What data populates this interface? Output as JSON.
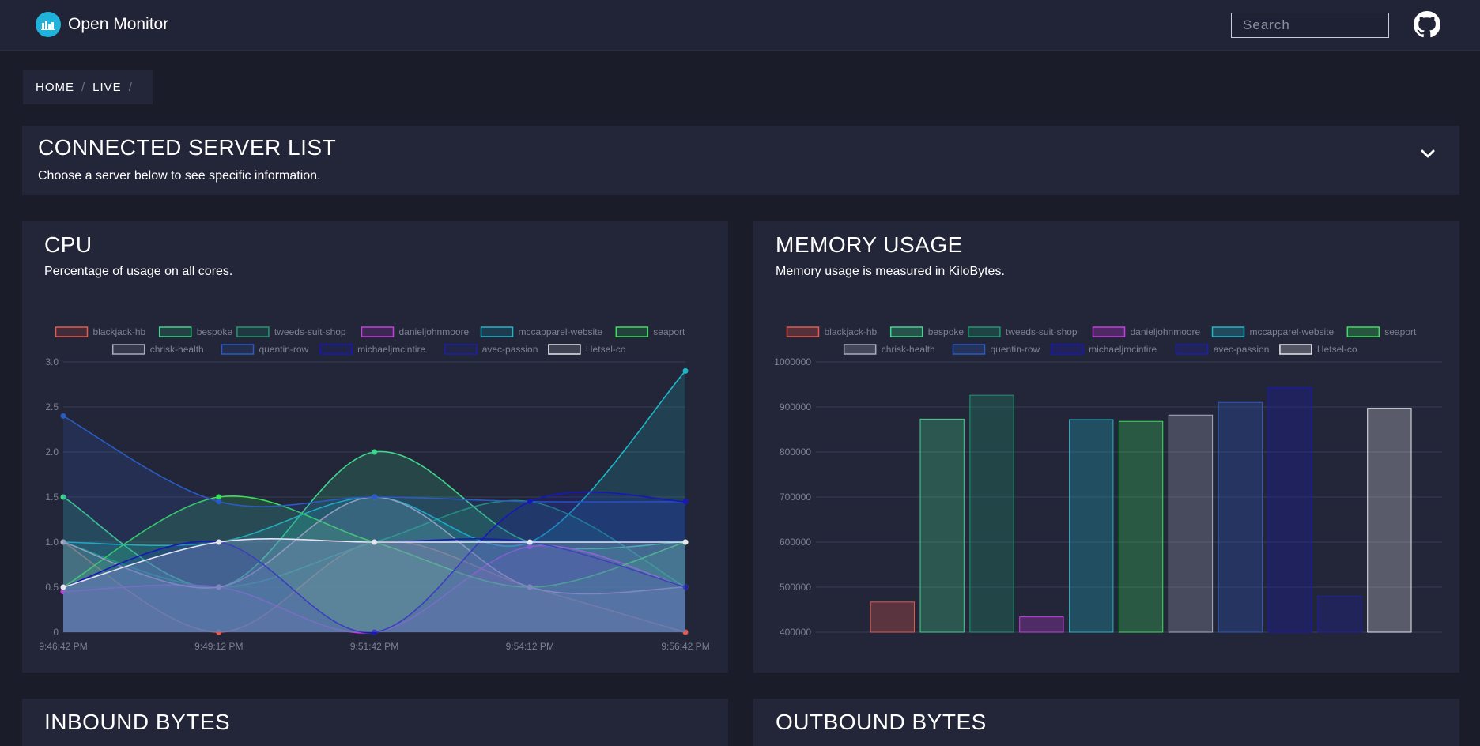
{
  "app": {
    "title": "Open Monitor"
  },
  "search": {
    "placeholder": "Search"
  },
  "breadcrumb": {
    "items": [
      "HOME",
      "LIVE"
    ]
  },
  "server_list": {
    "title": "CONNECTED SERVER LIST",
    "subtitle": "Choose a server below to see specific information."
  },
  "cpu": {
    "title": "CPU",
    "subtitle": "Percentage of usage on all cores."
  },
  "memory": {
    "title": "MEMORY USAGE",
    "subtitle": "Memory usage is measured in KiloBytes."
  },
  "inbound": {
    "title": "INBOUND BYTES"
  },
  "outbound": {
    "title": "OUTBOUND BYTES"
  },
  "colors": {
    "accent": "#1fb3dc",
    "panel": "#232639",
    "background": "#1a1c2a"
  },
  "chart_data": [
    {
      "type": "area",
      "title": "",
      "xlabel": "",
      "ylabel": "",
      "ylim": [
        0,
        3.0
      ],
      "yticks": [
        "0",
        "0.5",
        "1.0",
        "1.5",
        "2.0",
        "2.5",
        "3.0"
      ],
      "grid": true,
      "legend": "top",
      "x": [
        "9:46:42 PM",
        "9:49:12 PM",
        "9:51:42 PM",
        "9:54:12 PM",
        "9:56:42 PM"
      ],
      "series": [
        {
          "name": "blackjack-hb",
          "color": "#e8594a",
          "values": [
            1.0,
            0.0,
            1.0,
            0.5,
            0.0
          ]
        },
        {
          "name": "bespoke",
          "color": "#3fd68d",
          "values": [
            1.5,
            0.5,
            2.0,
            1.0,
            1.0
          ]
        },
        {
          "name": "tweeds-suit-shop",
          "color": "#1f9a6f",
          "values": [
            1.0,
            0.5,
            1.0,
            1.45,
            0.5
          ]
        },
        {
          "name": "danieljohnmoore",
          "color": "#c73ce0",
          "values": [
            0.45,
            0.5,
            0.0,
            0.95,
            0.5
          ]
        },
        {
          "name": "mccapparel-website",
          "color": "#1eb7c8",
          "values": [
            1.0,
            1.0,
            1.5,
            1.0,
            2.9
          ]
        },
        {
          "name": "seaport",
          "color": "#39e05a",
          "values": [
            0.5,
            1.5,
            1.0,
            0.5,
            1.0
          ]
        },
        {
          "name": "chrisk-health",
          "color": "#a8abbd",
          "values": [
            1.0,
            0.5,
            1.5,
            0.5,
            0.5
          ]
        },
        {
          "name": "quentin-row",
          "color": "#2a5bc4",
          "values": [
            2.4,
            1.45,
            1.5,
            1.45,
            1.45
          ]
        },
        {
          "name": "michaeljmcintire",
          "color": "#1718b8",
          "values": [
            0.5,
            1.0,
            0.0,
            1.45,
            1.45
          ]
        },
        {
          "name": "avec-passion",
          "color": "#1c1fa8",
          "values": [
            0.5,
            1.0,
            1.0,
            1.0,
            0.5
          ]
        },
        {
          "name": "Hetsel-co",
          "color": "#e6e7ee",
          "values": [
            0.5,
            1.0,
            1.0,
            1.0,
            1.0
          ]
        }
      ]
    },
    {
      "type": "bar",
      "title": "",
      "xlabel": "",
      "ylabel": "",
      "ylim": [
        400000,
        1000000
      ],
      "yticks": [
        "400000",
        "500000",
        "600000",
        "700000",
        "800000",
        "900000",
        "1000000"
      ],
      "grid": true,
      "legend": "top",
      "categories": [
        "blackjack-hb",
        "bespoke",
        "tweeds-suit-shop",
        "danieljohnmoore",
        "mccapparel-website",
        "seaport",
        "chrisk-health",
        "quentin-row",
        "michaeljmcintire",
        "avec-passion",
        "Hetsel-co"
      ],
      "colors": [
        "#e8594a",
        "#3fd68d",
        "#1f9a6f",
        "#c73ce0",
        "#1eb7c8",
        "#39e05a",
        "#a8abbd",
        "#2a5bc4",
        "#1718b8",
        "#1c1fa8",
        "#e6e7ee"
      ],
      "values": [
        467000,
        873000,
        926000,
        434000,
        872000,
        868000,
        882000,
        910000,
        943000,
        480000,
        897000
      ]
    }
  ]
}
